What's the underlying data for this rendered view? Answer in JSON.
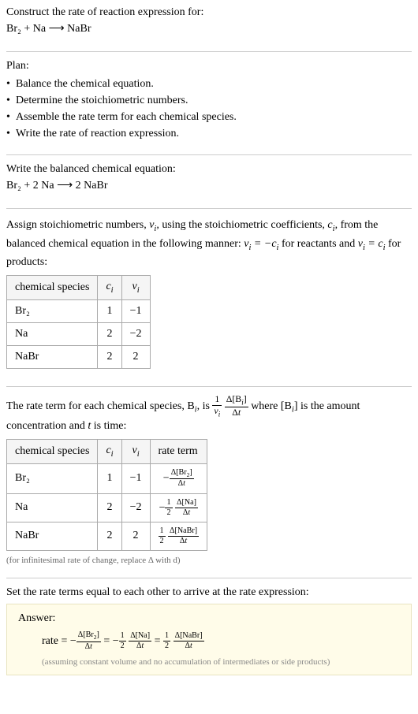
{
  "header": {
    "title": "Construct the rate of reaction expression for:",
    "equation": "Br₂ + Na ⟶ NaBr"
  },
  "plan": {
    "title": "Plan:",
    "items": [
      "Balance the chemical equation.",
      "Determine the stoichiometric numbers.",
      "Assemble the rate term for each chemical species.",
      "Write the rate of reaction expression."
    ]
  },
  "balanced": {
    "title": "Write the balanced chemical equation:",
    "equation": "Br₂ + 2 Na ⟶ 2 NaBr"
  },
  "stoich": {
    "desc_part1": "Assign stoichiometric numbers, ",
    "desc_part2": ", using the stoichiometric coefficients, ",
    "desc_part3": ", from the balanced chemical equation in the following manner: ",
    "desc_part4": " for reactants and ",
    "desc_part5": " for products:",
    "headers": [
      "chemical species",
      "cᵢ",
      "νᵢ"
    ],
    "rows": [
      {
        "species": "Br₂",
        "c": "1",
        "v": "−1"
      },
      {
        "species": "Na",
        "c": "2",
        "v": "−2"
      },
      {
        "species": "NaBr",
        "c": "2",
        "v": "2"
      }
    ]
  },
  "rateterm": {
    "desc_part1": "The rate term for each chemical species, B",
    "desc_part2": ", is ",
    "desc_part3": " where [B",
    "desc_part4": "] is the amount concentration and ",
    "desc_part5": " is time:",
    "headers": [
      "chemical species",
      "cᵢ",
      "νᵢ",
      "rate term"
    ],
    "rows": [
      {
        "species": "Br₂",
        "c": "1",
        "v": "−1"
      },
      {
        "species": "Na",
        "c": "2",
        "v": "−2"
      },
      {
        "species": "NaBr",
        "c": "2",
        "v": "2"
      }
    ],
    "caption": "(for infinitesimal rate of change, replace Δ with d)"
  },
  "final": {
    "title": "Set the rate terms equal to each other to arrive at the rate expression:",
    "answer_label": "Answer:",
    "rate_prefix": "rate = ",
    "note": "(assuming constant volume and no accumulation of intermediates or side products)"
  },
  "chart_data": {
    "type": "table",
    "title": "Stoichiometric numbers and rate terms",
    "tables": [
      {
        "name": "stoichiometric_numbers",
        "columns": [
          "chemical species",
          "c_i",
          "nu_i"
        ],
        "rows": [
          [
            "Br2",
            1,
            -1
          ],
          [
            "Na",
            2,
            -2
          ],
          [
            "NaBr",
            2,
            2
          ]
        ]
      },
      {
        "name": "rate_terms",
        "columns": [
          "chemical species",
          "c_i",
          "nu_i",
          "rate term"
        ],
        "rows": [
          [
            "Br2",
            1,
            -1,
            "-Δ[Br2]/Δt"
          ],
          [
            "Na",
            2,
            -2,
            "-(1/2)Δ[Na]/Δt"
          ],
          [
            "NaBr",
            2,
            2,
            "(1/2)Δ[NaBr]/Δt"
          ]
        ]
      }
    ],
    "rate_expression": "rate = -Δ[Br2]/Δt = -(1/2)Δ[Na]/Δt = (1/2)Δ[NaBr]/Δt"
  }
}
